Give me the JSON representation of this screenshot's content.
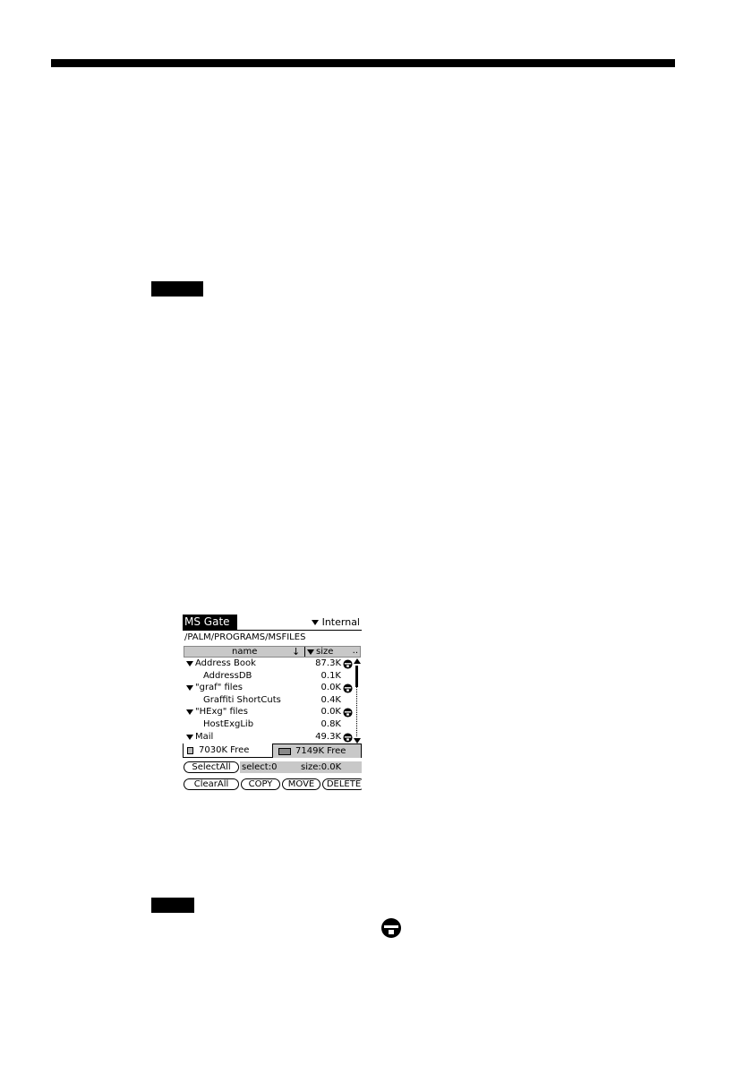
{
  "device": {
    "app_title": "MS Gate",
    "location": "Internal",
    "path": "/PALM/PROGRAMS/MSFILES",
    "columns": {
      "name": "name",
      "sort_arrow": "↓",
      "size": "size",
      "more": ".."
    },
    "rows": [
      {
        "kind": "folder",
        "name": "Address Book",
        "size": "87.3K",
        "locked": true
      },
      {
        "kind": "file",
        "name": "AddressDB",
        "size": "0.1K",
        "locked": false
      },
      {
        "kind": "folder",
        "name": "\"graf\" files",
        "size": "0.0K",
        "locked": true
      },
      {
        "kind": "file",
        "name": "Graffiti ShortCuts",
        "size": "0.4K",
        "locked": false
      },
      {
        "kind": "folder",
        "name": "\"HExg\" files",
        "size": "0.0K",
        "locked": true
      },
      {
        "kind": "file",
        "name": "HostExgLib",
        "size": "0.8K",
        "locked": false
      },
      {
        "kind": "folder",
        "name": "Mail",
        "size": "49.3K",
        "locked": true
      }
    ],
    "tabs": {
      "left": "7030K Free",
      "right": "7149K Free"
    },
    "status": {
      "select": "select:0",
      "size": "size:0.0K"
    },
    "buttons": {
      "select_all": "SelectAll",
      "clear_all": "ClearAll",
      "copy": "COPY",
      "move": "MOVE",
      "delete": "DELETE"
    }
  },
  "icons": {
    "lock": "lock-icon",
    "expand": "triangle-down-icon"
  },
  "colors": {
    "ink": "#000000",
    "header_gray": "#c8c8c8",
    "paper": "#ffffff"
  }
}
